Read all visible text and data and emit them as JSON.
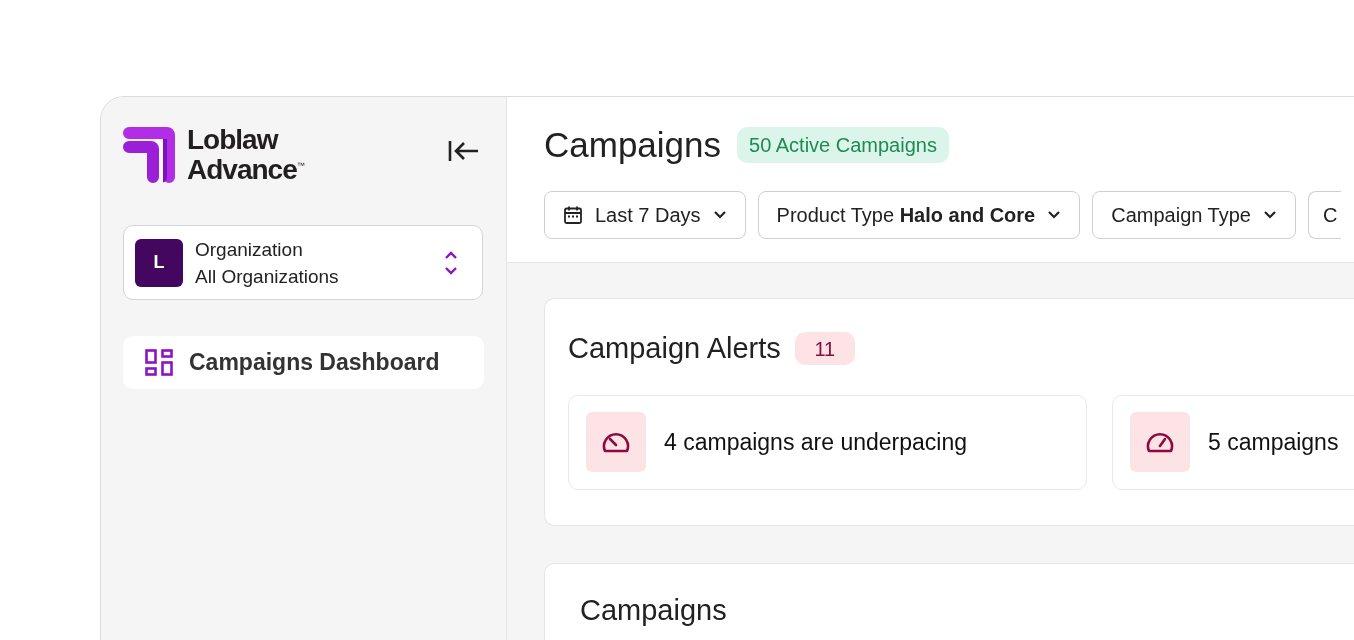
{
  "sidebar": {
    "logo": {
      "line_1": "Loblaw",
      "line_2": "Advance",
      "trademark": "™"
    },
    "org_selector": {
      "avatar": "L",
      "label": "Organization",
      "value": "All Organizations"
    },
    "nav_items": [
      {
        "label": "Campaigns Dashboard",
        "selected": true
      }
    ]
  },
  "header": {
    "title": "Campaigns",
    "badge": "50 Active Campaigns",
    "filters": [
      {
        "kind": "date",
        "label": "Last 7 Days"
      },
      {
        "kind": "select",
        "label": "Product Type **Halo and Core**"
      },
      {
        "kind": "select",
        "label": "Campaign Type"
      },
      {
        "kind": "cut",
        "label": "C"
      }
    ]
  },
  "alerts": {
    "title": "Campaign Alerts",
    "count": "11",
    "items": [
      {
        "kind": "underpacing",
        "text": "4 campaigns are underpacing"
      },
      {
        "kind": "overpacing",
        "text": "5 campaigns"
      }
    ]
  },
  "campaigns": {
    "title": "Campaigns"
  }
}
